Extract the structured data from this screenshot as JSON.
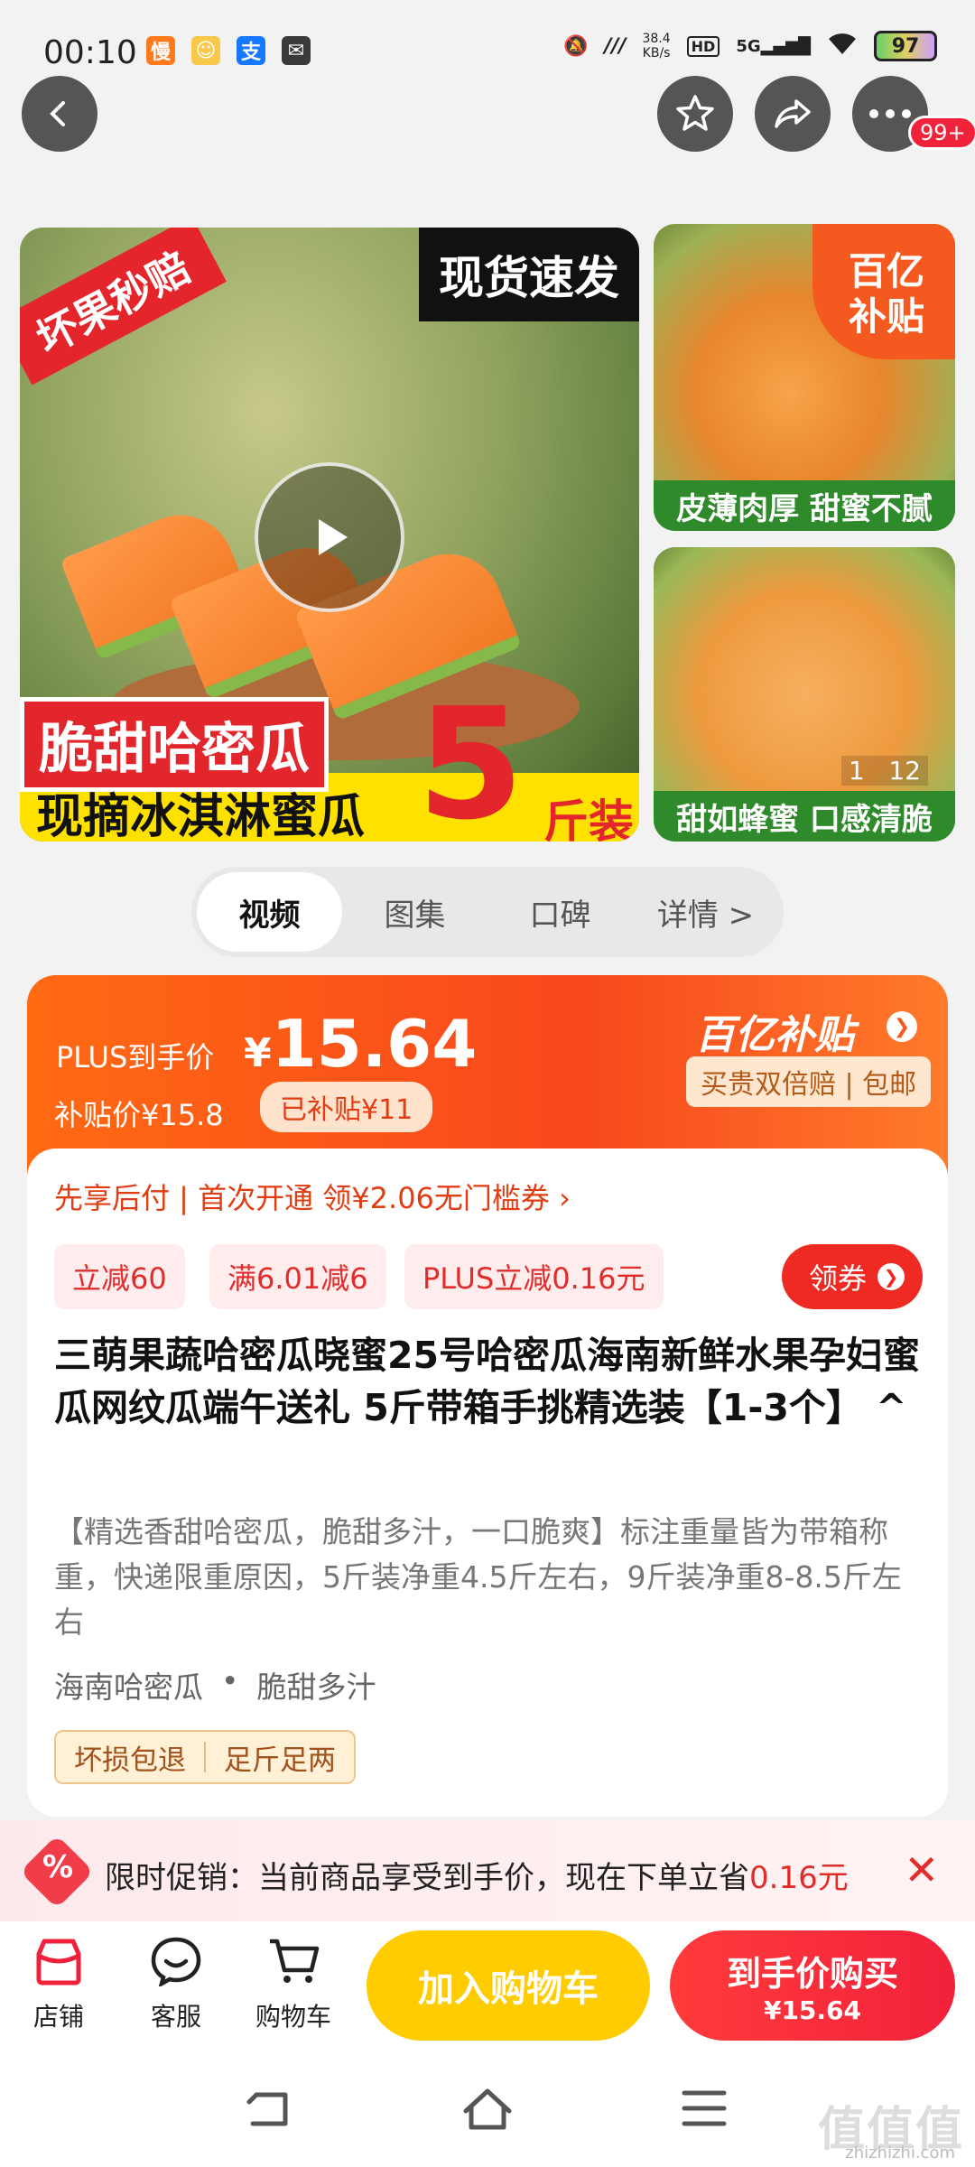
{
  "status_bar": {
    "time": "00:10",
    "speed_value": "38.4",
    "speed_unit": "KB/s",
    "hd": "HD",
    "network": "5G",
    "battery": "97"
  },
  "gallery": {
    "main": {
      "corner_tag": "坏果秒赔",
      "top_tag": "现货速发",
      "red_band": "脆甜哈密瓜",
      "yellow_band": "现摘冰淇淋蜜瓜",
      "big_number": "5",
      "unit": "斤装"
    },
    "side1_caption": "皮薄肉厚 甜蜜不腻",
    "side2_caption": "甜如蜂蜜 口感清脆",
    "badge_line1": "百亿",
    "badge_line2": "补贴",
    "counter_current": "1",
    "counter_total": "12"
  },
  "nav": {
    "badge": "99+"
  },
  "tabs": [
    {
      "label": "视频"
    },
    {
      "label": "图集"
    },
    {
      "label": "口碑"
    },
    {
      "label": "详情 >"
    }
  ],
  "price": {
    "label": "PLUS到手价",
    "currency": "¥",
    "value": "15.64",
    "subsidy_price": "补贴价¥15.8",
    "subsidized": "已补贴¥11",
    "brand": "百亿补贴",
    "guarantee": "买贵双倍赔 | 包邮"
  },
  "info": {
    "coupon_line": "先享后付 | 首次开通 领¥2.06无门槛券 ›",
    "chips": [
      "立减60",
      "满6.01减6",
      "PLUS立减0.16元"
    ],
    "get_coupon": "领券",
    "title": "三萌果蔬哈密瓜晓蜜25号哈密瓜海南新鲜水果孕妇蜜瓜网纹瓜端午送礼 5斤带箱手挑精选装【1-3个】 ^",
    "description": "【精选香甜哈密瓜，脆甜多汁，一口脆爽】标注重量皆为带箱称重，快递限重原因，5斤装净重4.5斤左右，9斤装净重8-8.5斤左右",
    "tag1": "海南哈密瓜",
    "tag_sep": "•",
    "tag2": "脆甜多汁",
    "promise1": "坏损包退",
    "promise2": "足斤足两"
  },
  "promo": {
    "icon": "%",
    "text_main": "限时促销：当前商品享受到手价，现在下单立省",
    "text_amount": "0.16元"
  },
  "bottom": {
    "shop": "店铺",
    "service": "客服",
    "cart": "购物车",
    "add_cart": "加入购物车",
    "buy_line1": "到手价购买",
    "buy_line2": "¥15.64"
  },
  "watermark": {
    "main": "值值值",
    "sub": "zhizhizhi.com"
  }
}
